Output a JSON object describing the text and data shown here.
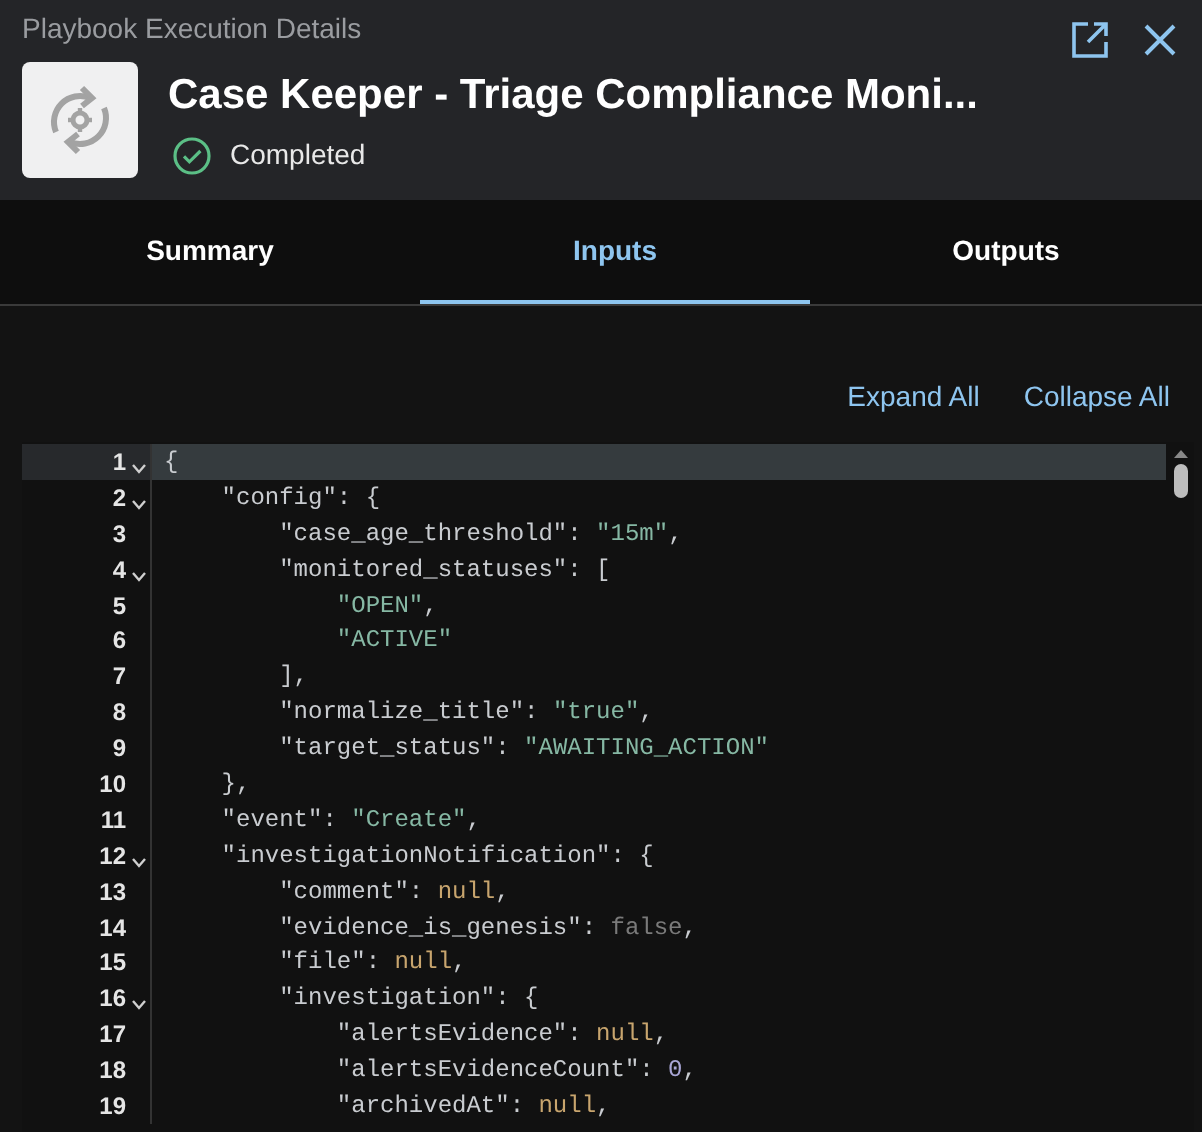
{
  "header": {
    "caption": "Playbook Execution Details",
    "title": "Case Keeper - Triage Compliance Moni...",
    "status": {
      "label": "Completed",
      "kind": "success"
    }
  },
  "tabs": [
    {
      "label": "Summary",
      "selected": false
    },
    {
      "label": "Inputs",
      "selected": true
    },
    {
      "label": "Outputs",
      "selected": false
    }
  ],
  "actions": [
    "Expand All",
    "Collapse All"
  ],
  "editor": {
    "lines": [
      {
        "number": "1",
        "foldable": true,
        "highlighted": true,
        "tokens": [
          {
            "kind": "punct",
            "text": "{"
          }
        ]
      },
      {
        "number": "2",
        "foldable": true,
        "highlighted": false,
        "tokens": [
          {
            "kind": "key",
            "text": "    \"config\""
          },
          {
            "kind": "punct",
            "text": ": {"
          }
        ]
      },
      {
        "number": "3",
        "foldable": false,
        "highlighted": false,
        "tokens": [
          {
            "kind": "key",
            "text": "        \"case_age_threshold\""
          },
          {
            "kind": "punct",
            "text": ": "
          },
          {
            "kind": "string",
            "text": "\"15m\""
          },
          {
            "kind": "punct",
            "text": ","
          }
        ]
      },
      {
        "number": "4",
        "foldable": true,
        "highlighted": false,
        "tokens": [
          {
            "kind": "key",
            "text": "        \"monitored_statuses\""
          },
          {
            "kind": "punct",
            "text": ": ["
          }
        ]
      },
      {
        "number": "5",
        "foldable": false,
        "highlighted": false,
        "tokens": [
          {
            "kind": "string",
            "text": "            \"OPEN\""
          },
          {
            "kind": "punct",
            "text": ","
          }
        ]
      },
      {
        "number": "6",
        "foldable": false,
        "highlighted": false,
        "tokens": [
          {
            "kind": "string",
            "text": "            \"ACTIVE\""
          }
        ]
      },
      {
        "number": "7",
        "foldable": false,
        "highlighted": false,
        "tokens": [
          {
            "kind": "punct",
            "text": "        ],"
          }
        ]
      },
      {
        "number": "8",
        "foldable": false,
        "highlighted": false,
        "tokens": [
          {
            "kind": "key",
            "text": "        \"normalize_title\""
          },
          {
            "kind": "punct",
            "text": ": "
          },
          {
            "kind": "string",
            "text": "\"true\""
          },
          {
            "kind": "punct",
            "text": ","
          }
        ]
      },
      {
        "number": "9",
        "foldable": false,
        "highlighted": false,
        "tokens": [
          {
            "kind": "key",
            "text": "        \"target_status\""
          },
          {
            "kind": "punct",
            "text": ": "
          },
          {
            "kind": "string",
            "text": "\"AWAITING_ACTION\""
          }
        ]
      },
      {
        "number": "10",
        "foldable": false,
        "highlighted": false,
        "tokens": [
          {
            "kind": "punct",
            "text": "    },"
          }
        ]
      },
      {
        "number": "11",
        "foldable": false,
        "highlighted": false,
        "tokens": [
          {
            "kind": "key",
            "text": "    \"event\""
          },
          {
            "kind": "punct",
            "text": ": "
          },
          {
            "kind": "string",
            "text": "\"Create\""
          },
          {
            "kind": "punct",
            "text": ","
          }
        ]
      },
      {
        "number": "12",
        "foldable": true,
        "highlighted": false,
        "tokens": [
          {
            "kind": "key",
            "text": "    \"investigationNotification\""
          },
          {
            "kind": "punct",
            "text": ": {"
          }
        ]
      },
      {
        "number": "13",
        "foldable": false,
        "highlighted": false,
        "tokens": [
          {
            "kind": "key",
            "text": "        \"comment\""
          },
          {
            "kind": "punct",
            "text": ": "
          },
          {
            "kind": "null",
            "text": "null"
          },
          {
            "kind": "punct",
            "text": ","
          }
        ]
      },
      {
        "number": "14",
        "foldable": false,
        "highlighted": false,
        "tokens": [
          {
            "kind": "key",
            "text": "        \"evidence_is_genesis\""
          },
          {
            "kind": "punct",
            "text": ": "
          },
          {
            "kind": "boolean",
            "text": "false"
          },
          {
            "kind": "punct",
            "text": ","
          }
        ]
      },
      {
        "number": "15",
        "foldable": false,
        "highlighted": false,
        "tokens": [
          {
            "kind": "key",
            "text": "        \"file\""
          },
          {
            "kind": "punct",
            "text": ": "
          },
          {
            "kind": "null",
            "text": "null"
          },
          {
            "kind": "punct",
            "text": ","
          }
        ]
      },
      {
        "number": "16",
        "foldable": true,
        "highlighted": false,
        "tokens": [
          {
            "kind": "key",
            "text": "        \"investigation\""
          },
          {
            "kind": "punct",
            "text": ": {"
          }
        ]
      },
      {
        "number": "17",
        "foldable": false,
        "highlighted": false,
        "tokens": [
          {
            "kind": "key",
            "text": "            \"alertsEvidence\""
          },
          {
            "kind": "punct",
            "text": ": "
          },
          {
            "kind": "null",
            "text": "null"
          },
          {
            "kind": "punct",
            "text": ","
          }
        ]
      },
      {
        "number": "18",
        "foldable": false,
        "highlighted": false,
        "tokens": [
          {
            "kind": "key",
            "text": "            \"alertsEvidenceCount\""
          },
          {
            "kind": "punct",
            "text": ": "
          },
          {
            "kind": "number",
            "text": "0"
          },
          {
            "kind": "punct",
            "text": ","
          }
        ]
      },
      {
        "number": "19",
        "foldable": false,
        "highlighted": false,
        "tokens": [
          {
            "kind": "key",
            "text": "            \"archivedAt\""
          },
          {
            "kind": "punct",
            "text": ": "
          },
          {
            "kind": "null",
            "text": "null"
          },
          {
            "kind": "punct",
            "text": ","
          }
        ]
      }
    ]
  }
}
